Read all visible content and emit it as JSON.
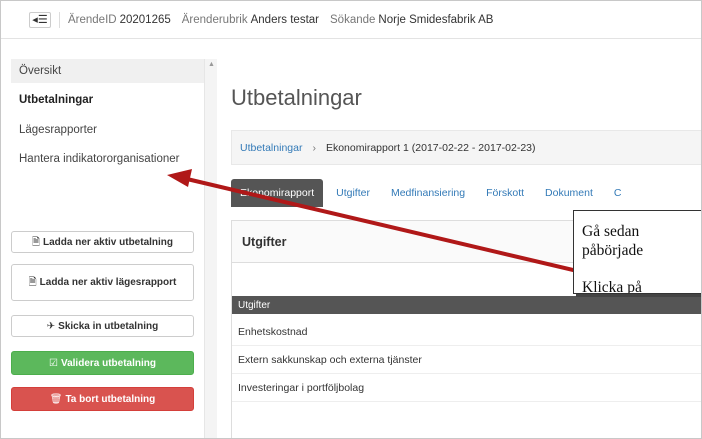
{
  "topbar": {
    "toggle_icon": "menu-collapse-icon",
    "arende_id_label": "ÄrendeID",
    "arende_id_value": "20201265",
    "rubrik_label": "Ärenderubrik",
    "rubrik_value": "Anders testar",
    "sokande_label": "Sökande",
    "sokande_value": "Norje Smidesfabrik AB"
  },
  "sidebar": {
    "items": [
      {
        "label": "Översikt"
      },
      {
        "label": "Utbetalningar"
      },
      {
        "label": "Lägesrapporter"
      },
      {
        "label": "Hantera indikatororganisationer"
      }
    ],
    "buttons": {
      "download_payment": "Ladda ner aktiv utbetalning",
      "download_status": "Ladda ner aktiv lägesrapport",
      "send_payment": "Skicka in utbetalning",
      "validate_payment": "Validera utbetalning",
      "delete_payment": "Ta bort utbetalning"
    }
  },
  "main": {
    "title": "Utbetalningar",
    "breadcrumb": {
      "root": "Utbetalningar",
      "separator": "›",
      "current": "Ekonomirapport 1 (2017-02-22 - 2017-02-23)"
    },
    "tabs": [
      {
        "label": "Ekonomirapport",
        "active": true
      },
      {
        "label": "Utgifter"
      },
      {
        "label": "Medfinansiering"
      },
      {
        "label": "Förskott"
      },
      {
        "label": "Dokument"
      },
      {
        "label": "C"
      }
    ],
    "panel": {
      "title": "Utgifter",
      "table_header": "Utgifter",
      "rows": [
        "Enhetskostnad",
        "Extern sakkunskap och externa tjänster",
        "Investeringar i portföljbolag"
      ]
    }
  },
  "callout": {
    "line1": "Gå sedan",
    "line2": "påbörjade",
    "line3": "Klicka på"
  },
  "colors": {
    "accent_link": "#337ab7",
    "success": "#5cb85c",
    "danger": "#d9534f",
    "annotation_arrow": "#b01818"
  }
}
